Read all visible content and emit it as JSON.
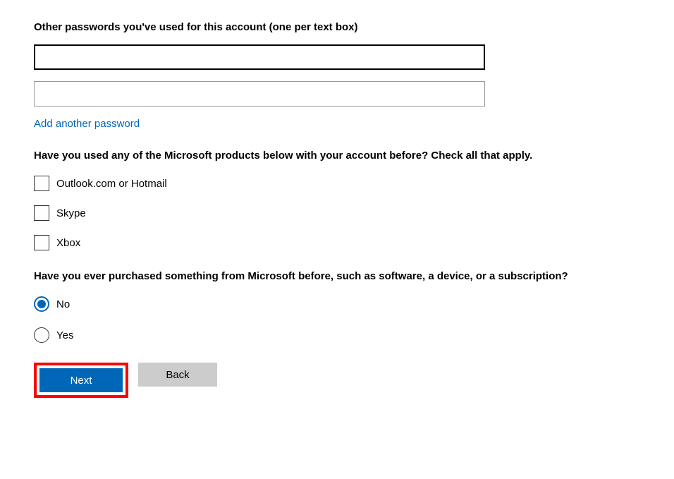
{
  "passwords": {
    "label": "Other passwords you've used for this account (one per text box)",
    "field1_value": "",
    "field2_value": "",
    "add_link": "Add another password"
  },
  "products": {
    "question": "Have you used any of the Microsoft products below with your account before? Check all that apply.",
    "items": [
      {
        "label": "Outlook.com or Hotmail"
      },
      {
        "label": "Skype"
      },
      {
        "label": "Xbox"
      }
    ]
  },
  "purchase": {
    "question": "Have you ever purchased something from Microsoft before, such as software, a device, or a subscription?",
    "options": [
      {
        "label": "No",
        "selected": true
      },
      {
        "label": "Yes",
        "selected": false
      }
    ]
  },
  "buttons": {
    "next": "Next",
    "back": "Back"
  }
}
